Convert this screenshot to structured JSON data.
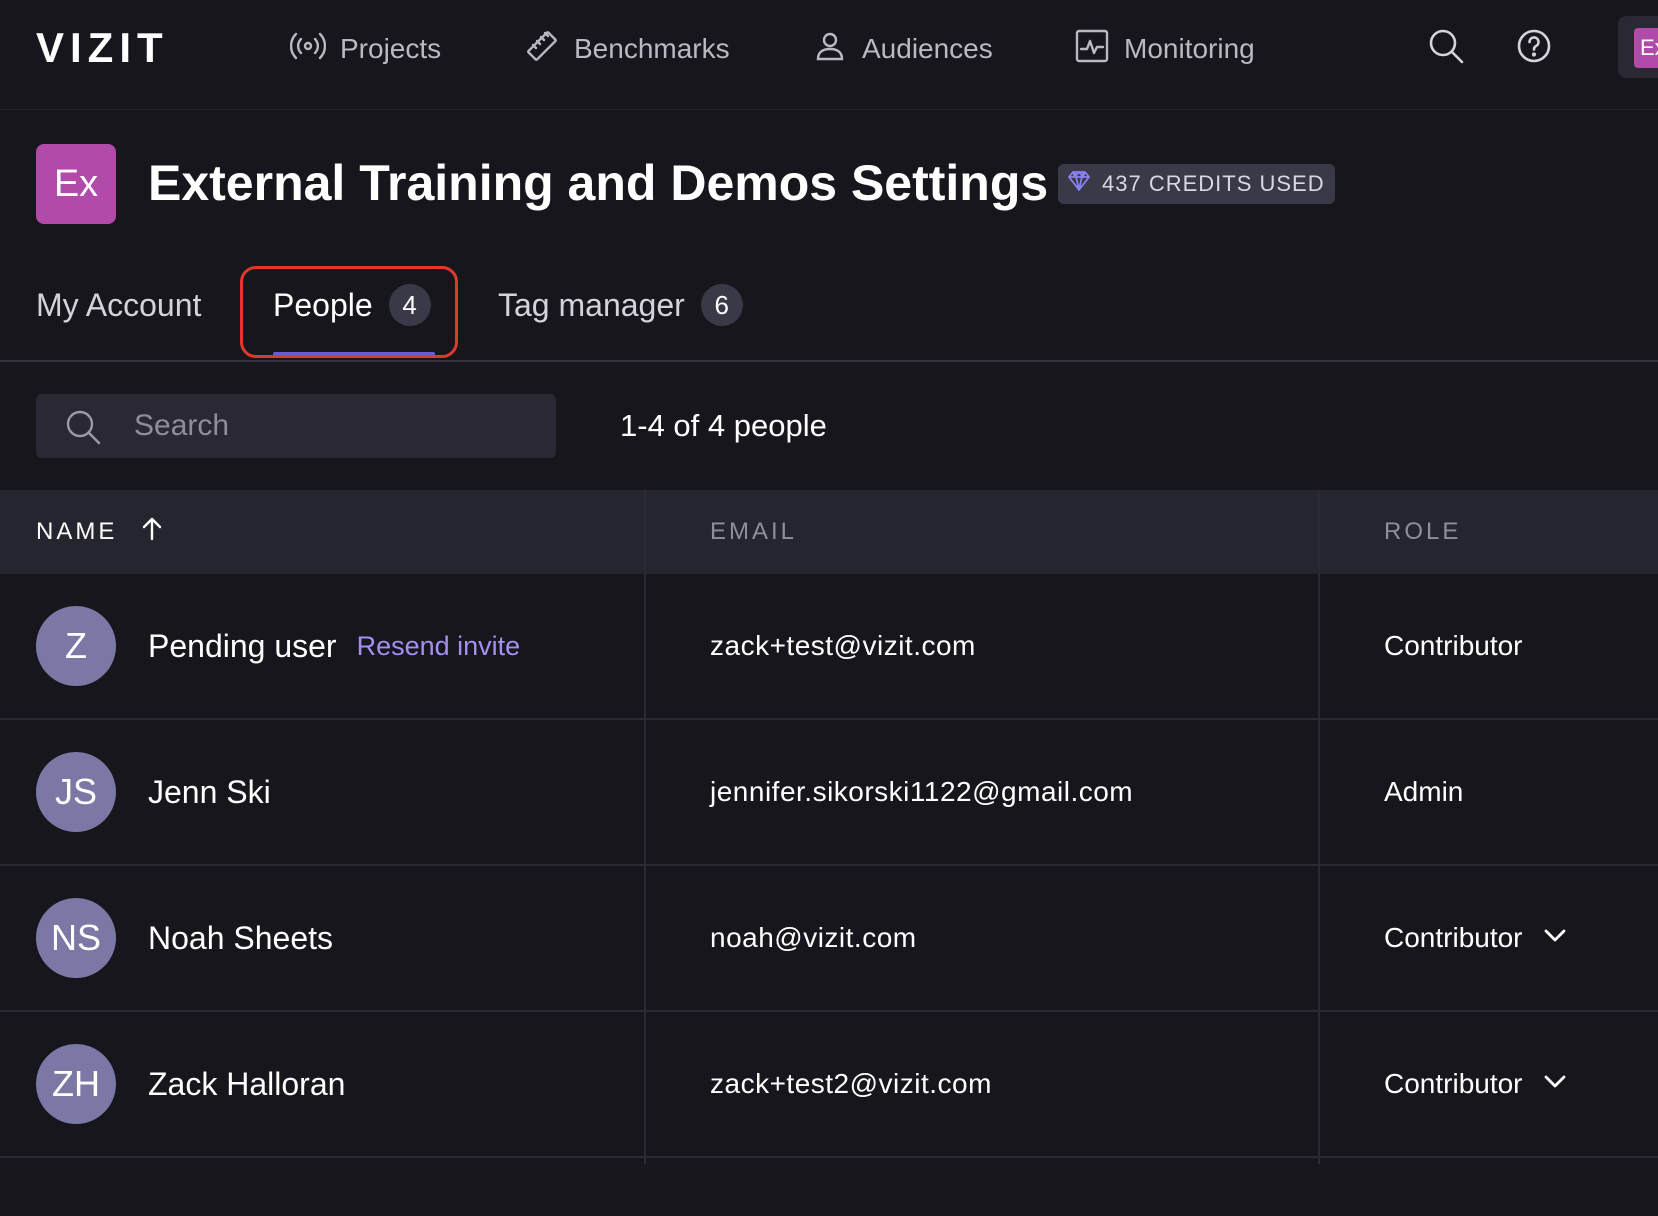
{
  "nav": {
    "logo": "VIZIT",
    "items": [
      {
        "label": "Projects",
        "icon": "broadcast-icon"
      },
      {
        "label": "Benchmarks",
        "icon": "ruler-icon"
      },
      {
        "label": "Audiences",
        "icon": "person-icon"
      },
      {
        "label": "Monitoring",
        "icon": "pulse-chart-icon"
      }
    ],
    "user_initials": "Ex"
  },
  "header": {
    "org_initials": "Ex",
    "title": "External Training and Demos Settings",
    "credits": "437 CREDITS USED"
  },
  "tabs": [
    {
      "label": "My Account",
      "count": null
    },
    {
      "label": "People",
      "count": "4",
      "active": true
    },
    {
      "label": "Tag manager",
      "count": "6"
    }
  ],
  "search": {
    "placeholder": "Search"
  },
  "results_text": "1-4 of 4 people",
  "table": {
    "columns": [
      "NAME",
      "EMAIL",
      "ROLE"
    ],
    "rows": [
      {
        "initials": "Z",
        "name": "Pending user",
        "action": "Resend invite",
        "email": "zack+test@vizit.com",
        "role": "Contributor",
        "editable": false
      },
      {
        "initials": "JS",
        "name": "Jenn Ski",
        "action": "",
        "email": "jennifer.sikorski1122@gmail.com",
        "role": "Admin",
        "editable": false
      },
      {
        "initials": "NS",
        "name": "Noah Sheets",
        "action": "",
        "email": "noah@vizit.com",
        "role": "Contributor",
        "editable": true
      },
      {
        "initials": "ZH",
        "name": "Zack Halloran",
        "action": "",
        "email": "zack+test2@vizit.com",
        "role": "Contributor",
        "editable": true
      }
    ]
  },
  "colors": {
    "background": "#17161d",
    "accent": "#6b5bd6",
    "link": "#a58ef0",
    "org_avatar": "#b14aa8",
    "highlight": "#e0392b"
  }
}
